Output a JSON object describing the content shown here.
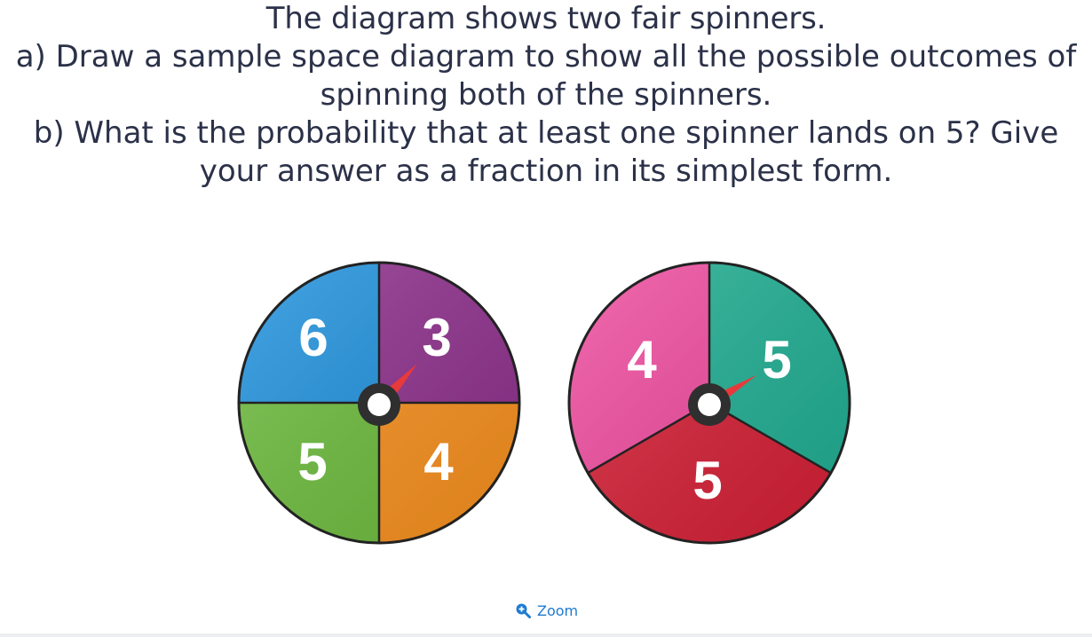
{
  "question": {
    "line1": "The diagram shows two fair spinners.",
    "line2": "a) Draw a sample space diagram to show all the possible outcomes of",
    "line3": "spinning both of the spinners.",
    "line4": "b) What is the probability that at least one spinner lands on 5? Give",
    "line5": "your answer as a fraction in its simplest form."
  },
  "spinner_a": {
    "sections": [
      {
        "label": "6",
        "color": "#1e90dc"
      },
      {
        "label": "3",
        "color": "#8e2f8c"
      },
      {
        "label": "4",
        "color": "#f7901e"
      },
      {
        "label": "5",
        "color": "#6cbb3c"
      }
    ]
  },
  "spinner_b": {
    "sections": [
      {
        "label": "4",
        "color": "#ef4a9e"
      },
      {
        "label": "5",
        "color": "#1fae92"
      },
      {
        "label": "5",
        "color": "#d51f35"
      }
    ]
  },
  "pointer_color": "#e83a3a",
  "zoom": {
    "label": "Zoom",
    "icon": "zoom-in-icon"
  }
}
